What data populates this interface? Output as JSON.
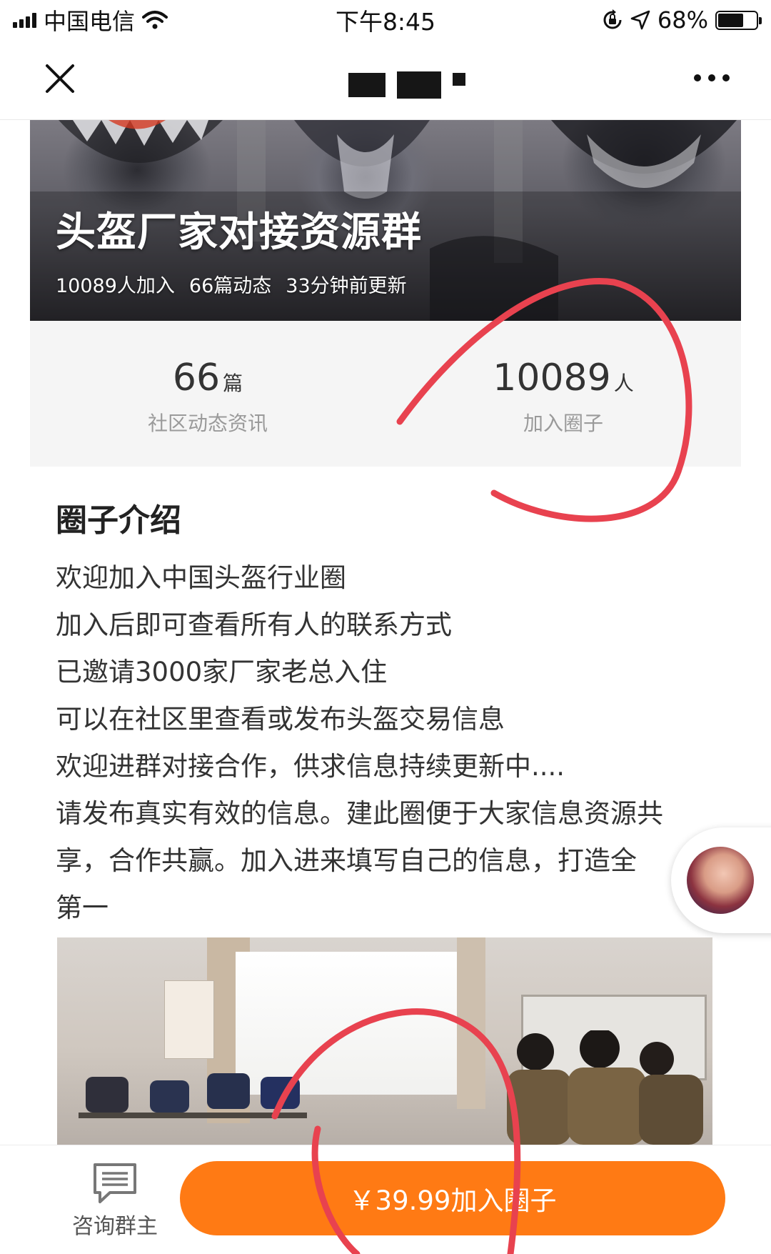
{
  "status_bar": {
    "carrier": "中国电信",
    "time": "下午8:45",
    "battery_percent": "68%",
    "icons": [
      "signal-icon",
      "wifi-icon",
      "orientation-lock-icon",
      "location-icon",
      "battery-icon"
    ]
  },
  "nav": {
    "close_icon": "close-icon",
    "more_icon": "more-icon"
  },
  "banner": {
    "title": "头盔厂家对接资源群",
    "members_meta": "10089人加入",
    "posts_meta": "66篇动态",
    "updated_meta": "33分钟前更新"
  },
  "stats": [
    {
      "number": "66",
      "unit": "篇",
      "label": "社区动态资讯"
    },
    {
      "number": "10089",
      "unit": "人",
      "label": "加入圈子"
    }
  ],
  "intro": {
    "title": "圈子介绍",
    "lines": [
      "欢迎加入中国头盔行业圈",
      "加入后即可查看所有人的联系方式",
      "已邀请3000家厂家老总入住",
      "可以在社区里查看或发布头盔交易信息",
      "欢迎进群对接合作，供求信息持续更新中....",
      "请发布真实有效的信息。建此圈便于大家信息资源共",
      "享，合作共赢。加入进来填写自己的信息，打造全",
      "第一"
    ]
  },
  "bottom_bar": {
    "consult_label": "咨询群主",
    "consult_icon": "message-icon",
    "join_label": "￥39.99加入圈子"
  },
  "colors": {
    "accent": "#ff7a14",
    "annotation": "#e8424f",
    "stats_bg": "#f5f5f5",
    "muted_text": "#9a9a9a"
  }
}
